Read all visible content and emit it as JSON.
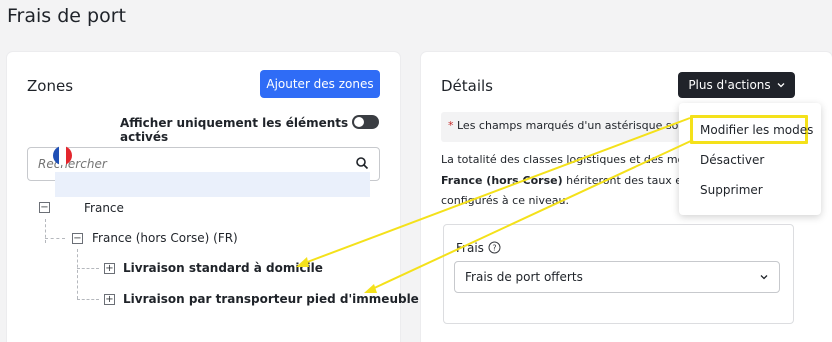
{
  "page": {
    "title": "Frais de port"
  },
  "zones": {
    "title": "Zones",
    "add_button": "Ajouter des zones",
    "toggle_label": "Afficher uniquement les éléments activés",
    "search_placeholder": "Rechercher",
    "tree": {
      "root": {
        "toggle": "−",
        "label": "France"
      },
      "child": {
        "toggle": "−",
        "label": "France (hors Corse) (FR)"
      },
      "leaves": [
        {
          "toggle": "+",
          "label": "Livraison standard à domicile"
        },
        {
          "toggle": "+",
          "label": "Livraison par transporteur pied d'immeuble"
        }
      ]
    }
  },
  "details": {
    "title": "Détails",
    "actions_button": "Plus d'actions",
    "notice_star": "*",
    "notice_text": " Les champs marqués d'un astérisque sont",
    "desc_line1": "La totalité des classes logistiques et des mod",
    "desc_line2_bold": "France (hors Corse)",
    "desc_line2": " hériteront des taux et de",
    "desc_line3": "configurés à ce niveau.",
    "fees_label": "Frais",
    "fees_value": "Frais de port offerts"
  },
  "dropdown": {
    "items": [
      "Modifier les modes",
      "Désactiver",
      "Supprimer"
    ]
  },
  "colors": {
    "primary": "#2f6cf6",
    "dark_button": "#20232a",
    "highlight": "#f4e11a",
    "required": "#c62828"
  }
}
